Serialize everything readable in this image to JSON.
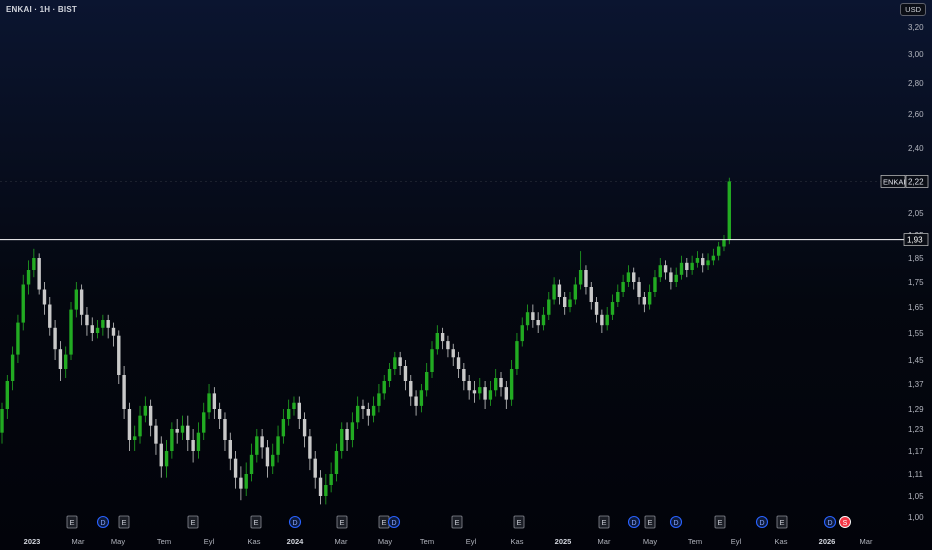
{
  "header": {
    "title": "ENKAI · 1H · BIST",
    "currency": "USD"
  },
  "colors": {
    "background_top": "#0b1530",
    "background_bottom": "#02030a",
    "up_candle": "#22ab22",
    "down_candle": "#c9c9c9",
    "level_line": "#ffffff",
    "axis_text": "#b2b5be"
  },
  "chart_data": {
    "type": "candlestick",
    "title": "ENKAI · 1H · BIST",
    "ylabel": "USD",
    "ylim": [
      1.0,
      3.25
    ],
    "y_ticks": [
      "1,00",
      "1,05",
      "1,11",
      "1,17",
      "1,23",
      "1,29",
      "1,37",
      "1,45",
      "1,55",
      "1,65",
      "1,75",
      "1,85",
      "1,95",
      "2,05",
      "2,40",
      "2,60",
      "2,80",
      "3,00",
      "3,20"
    ],
    "x_ticks": [
      "2023",
      "Mar",
      "May",
      "Tem",
      "Eyl",
      "Kas",
      "2024",
      "Mar",
      "May",
      "Tem",
      "Eyl",
      "Kas",
      "2025",
      "Mar",
      "May",
      "Tem",
      "Eyl",
      "Kas",
      "2026",
      "Mar"
    ],
    "bold_x_ticks": [
      "2023",
      "2024",
      "2025",
      "2026"
    ],
    "horizontal_level": 1.93,
    "price_labels": [
      {
        "symbol": "ENKAI",
        "value": "2,22"
      },
      {
        "value": "1,93"
      }
    ],
    "event_markers": [
      {
        "x": "Jan 2023",
        "label": "E"
      },
      {
        "x": "Apr 2023",
        "label": "D"
      },
      {
        "x": "May 2023",
        "label": "E"
      },
      {
        "x": "Aug 2023",
        "label": "E"
      },
      {
        "x": "Nov 2023",
        "label": "E"
      },
      {
        "x": "Jan 2024",
        "label": "D"
      },
      {
        "x": "Mar 2024",
        "label": "E"
      },
      {
        "x": "May 2024",
        "label": "E"
      },
      {
        "x": "May 2024",
        "label": "D"
      },
      {
        "x": "Aug 2024",
        "label": "E"
      },
      {
        "x": "Oct 2024",
        "label": "E"
      },
      {
        "x": "Mar 2025",
        "label": "E"
      },
      {
        "x": "Apr 2025",
        "label": "D"
      },
      {
        "x": "May 2025",
        "label": "E"
      },
      {
        "x": "Jun 2025",
        "label": "D"
      },
      {
        "x": "Aug 2025",
        "label": "E"
      },
      {
        "x": "Oct 2025",
        "label": "D"
      },
      {
        "x": "Nov 2025",
        "label": "E"
      },
      {
        "x": "Feb 2026",
        "label": "D"
      },
      {
        "x": "Feb 2026",
        "label": "S"
      }
    ],
    "x_range": [
      0,
      162
    ],
    "candles": [
      [
        0,
        1.22,
        1.29,
        1.19,
        1.31
      ],
      [
        1,
        1.29,
        1.38,
        1.26,
        1.4
      ],
      [
        2,
        1.38,
        1.47,
        1.35,
        1.5
      ],
      [
        3,
        1.47,
        1.59,
        1.44,
        1.62
      ],
      [
        4,
        1.59,
        1.74,
        1.56,
        1.78
      ],
      [
        5,
        1.74,
        1.8,
        1.7,
        1.84
      ],
      [
        6,
        1.8,
        1.85,
        1.77,
        1.89
      ],
      [
        7,
        1.85,
        1.72,
        1.7,
        1.87
      ],
      [
        8,
        1.72,
        1.66,
        1.62,
        1.75
      ],
      [
        9,
        1.66,
        1.57,
        1.54,
        1.69
      ],
      [
        10,
        1.57,
        1.49,
        1.45,
        1.6
      ],
      [
        11,
        1.49,
        1.42,
        1.38,
        1.52
      ],
      [
        12,
        1.42,
        1.47,
        1.39,
        1.5
      ],
      [
        13,
        1.47,
        1.64,
        1.45,
        1.67
      ],
      [
        14,
        1.64,
        1.72,
        1.61,
        1.75
      ],
      [
        15,
        1.72,
        1.62,
        1.58,
        1.74
      ],
      [
        16,
        1.62,
        1.58,
        1.54,
        1.65
      ],
      [
        17,
        1.58,
        1.55,
        1.52,
        1.61
      ],
      [
        18,
        1.55,
        1.57,
        1.53,
        1.6
      ],
      [
        19,
        1.57,
        1.6,
        1.54,
        1.62
      ],
      [
        20,
        1.6,
        1.57,
        1.53,
        1.62
      ],
      [
        21,
        1.57,
        1.54,
        1.5,
        1.59
      ],
      [
        22,
        1.54,
        1.4,
        1.37,
        1.56
      ],
      [
        23,
        1.4,
        1.29,
        1.26,
        1.43
      ],
      [
        24,
        1.29,
        1.2,
        1.17,
        1.31
      ],
      [
        25,
        1.2,
        1.21,
        1.17,
        1.24
      ],
      [
        26,
        1.21,
        1.27,
        1.19,
        1.3
      ],
      [
        27,
        1.27,
        1.3,
        1.25,
        1.33
      ],
      [
        28,
        1.3,
        1.24,
        1.21,
        1.32
      ],
      [
        29,
        1.24,
        1.19,
        1.16,
        1.26
      ],
      [
        30,
        1.19,
        1.13,
        1.1,
        1.21
      ],
      [
        31,
        1.13,
        1.17,
        1.1,
        1.2
      ],
      [
        32,
        1.17,
        1.23,
        1.15,
        1.25
      ],
      [
        33,
        1.23,
        1.22,
        1.19,
        1.26
      ],
      [
        34,
        1.22,
        1.24,
        1.2,
        1.27
      ],
      [
        35,
        1.24,
        1.2,
        1.17,
        1.27
      ],
      [
        36,
        1.2,
        1.17,
        1.14,
        1.23
      ],
      [
        37,
        1.17,
        1.22,
        1.15,
        1.25
      ],
      [
        38,
        1.22,
        1.28,
        1.2,
        1.31
      ],
      [
        39,
        1.28,
        1.34,
        1.26,
        1.37
      ],
      [
        40,
        1.34,
        1.29,
        1.26,
        1.36
      ],
      [
        41,
        1.29,
        1.26,
        1.23,
        1.31
      ],
      [
        42,
        1.26,
        1.2,
        1.17,
        1.28
      ],
      [
        43,
        1.2,
        1.15,
        1.12,
        1.22
      ],
      [
        44,
        1.15,
        1.1,
        1.07,
        1.17
      ],
      [
        45,
        1.1,
        1.07,
        1.04,
        1.13
      ],
      [
        46,
        1.07,
        1.11,
        1.05,
        1.14
      ],
      [
        47,
        1.11,
        1.16,
        1.09,
        1.19
      ],
      [
        48,
        1.16,
        1.21,
        1.14,
        1.23
      ],
      [
        49,
        1.21,
        1.18,
        1.15,
        1.23
      ],
      [
        50,
        1.18,
        1.13,
        1.1,
        1.2
      ],
      [
        51,
        1.13,
        1.16,
        1.11,
        1.19
      ],
      [
        52,
        1.16,
        1.21,
        1.14,
        1.24
      ],
      [
        53,
        1.21,
        1.26,
        1.19,
        1.29
      ],
      [
        54,
        1.26,
        1.29,
        1.24,
        1.32
      ],
      [
        55,
        1.29,
        1.31,
        1.27,
        1.33
      ],
      [
        56,
        1.31,
        1.26,
        1.23,
        1.33
      ],
      [
        57,
        1.26,
        1.21,
        1.18,
        1.28
      ],
      [
        58,
        1.21,
        1.15,
        1.12,
        1.23
      ],
      [
        59,
        1.15,
        1.1,
        1.07,
        1.17
      ],
      [
        60,
        1.1,
        1.05,
        1.03,
        1.12
      ],
      [
        61,
        1.05,
        1.08,
        1.03,
        1.11
      ],
      [
        62,
        1.08,
        1.11,
        1.06,
        1.14
      ],
      [
        63,
        1.11,
        1.17,
        1.09,
        1.19
      ],
      [
        64,
        1.17,
        1.23,
        1.15,
        1.25
      ],
      [
        65,
        1.23,
        1.2,
        1.17,
        1.25
      ],
      [
        66,
        1.2,
        1.25,
        1.18,
        1.28
      ],
      [
        67,
        1.25,
        1.3,
        1.23,
        1.33
      ],
      [
        68,
        1.3,
        1.29,
        1.26,
        1.32
      ],
      [
        69,
        1.29,
        1.27,
        1.24,
        1.31
      ],
      [
        70,
        1.27,
        1.3,
        1.25,
        1.33
      ],
      [
        71,
        1.3,
        1.34,
        1.28,
        1.37
      ],
      [
        72,
        1.34,
        1.38,
        1.32,
        1.4
      ],
      [
        73,
        1.38,
        1.42,
        1.36,
        1.44
      ],
      [
        74,
        1.42,
        1.46,
        1.4,
        1.48
      ],
      [
        75,
        1.46,
        1.43,
        1.4,
        1.48
      ],
      [
        76,
        1.43,
        1.38,
        1.35,
        1.45
      ],
      [
        77,
        1.38,
        1.33,
        1.3,
        1.4
      ],
      [
        78,
        1.33,
        1.3,
        1.27,
        1.35
      ],
      [
        79,
        1.3,
        1.35,
        1.28,
        1.37
      ],
      [
        80,
        1.35,
        1.41,
        1.33,
        1.44
      ],
      [
        81,
        1.41,
        1.49,
        1.39,
        1.52
      ],
      [
        82,
        1.49,
        1.55,
        1.47,
        1.58
      ],
      [
        83,
        1.55,
        1.52,
        1.49,
        1.57
      ],
      [
        84,
        1.52,
        1.49,
        1.46,
        1.54
      ],
      [
        85,
        1.49,
        1.46,
        1.43,
        1.51
      ],
      [
        86,
        1.46,
        1.42,
        1.39,
        1.48
      ],
      [
        87,
        1.42,
        1.38,
        1.35,
        1.44
      ],
      [
        88,
        1.38,
        1.35,
        1.32,
        1.4
      ],
      [
        89,
        1.35,
        1.34,
        1.31,
        1.38
      ],
      [
        90,
        1.34,
        1.36,
        1.32,
        1.39
      ],
      [
        91,
        1.36,
        1.32,
        1.29,
        1.38
      ],
      [
        92,
        1.32,
        1.35,
        1.3,
        1.38
      ],
      [
        93,
        1.35,
        1.39,
        1.33,
        1.42
      ],
      [
        94,
        1.39,
        1.36,
        1.33,
        1.41
      ],
      [
        95,
        1.36,
        1.32,
        1.29,
        1.38
      ],
      [
        96,
        1.32,
        1.42,
        1.3,
        1.45
      ],
      [
        97,
        1.42,
        1.52,
        1.4,
        1.55
      ],
      [
        98,
        1.52,
        1.58,
        1.5,
        1.61
      ],
      [
        99,
        1.58,
        1.63,
        1.56,
        1.66
      ],
      [
        100,
        1.63,
        1.6,
        1.57,
        1.66
      ],
      [
        101,
        1.6,
        1.58,
        1.55,
        1.63
      ],
      [
        102,
        1.58,
        1.62,
        1.56,
        1.65
      ],
      [
        103,
        1.62,
        1.68,
        1.6,
        1.71
      ],
      [
        104,
        1.68,
        1.74,
        1.66,
        1.77
      ],
      [
        105,
        1.74,
        1.69,
        1.66,
        1.76
      ],
      [
        106,
        1.69,
        1.65,
        1.62,
        1.71
      ],
      [
        107,
        1.65,
        1.68,
        1.63,
        1.71
      ],
      [
        108,
        1.68,
        1.74,
        1.66,
        1.77
      ],
      [
        109,
        1.74,
        1.8,
        1.72,
        1.88
      ],
      [
        110,
        1.8,
        1.73,
        1.7,
        1.82
      ],
      [
        111,
        1.73,
        1.67,
        1.64,
        1.75
      ],
      [
        112,
        1.67,
        1.62,
        1.59,
        1.69
      ],
      [
        113,
        1.62,
        1.58,
        1.55,
        1.64
      ],
      [
        114,
        1.58,
        1.62,
        1.56,
        1.65
      ],
      [
        115,
        1.62,
        1.67,
        1.6,
        1.7
      ],
      [
        116,
        1.67,
        1.71,
        1.65,
        1.74
      ],
      [
        117,
        1.71,
        1.75,
        1.69,
        1.78
      ],
      [
        118,
        1.75,
        1.79,
        1.73,
        1.82
      ],
      [
        119,
        1.79,
        1.75,
        1.72,
        1.81
      ],
      [
        120,
        1.75,
        1.69,
        1.66,
        1.77
      ],
      [
        121,
        1.69,
        1.66,
        1.63,
        1.71
      ],
      [
        122,
        1.66,
        1.71,
        1.64,
        1.74
      ],
      [
        123,
        1.71,
        1.77,
        1.69,
        1.8
      ],
      [
        124,
        1.77,
        1.82,
        1.75,
        1.85
      ],
      [
        125,
        1.82,
        1.79,
        1.76,
        1.84
      ],
      [
        126,
        1.79,
        1.75,
        1.72,
        1.81
      ],
      [
        127,
        1.75,
        1.78,
        1.73,
        1.81
      ],
      [
        128,
        1.78,
        1.83,
        1.76,
        1.86
      ],
      [
        129,
        1.83,
        1.8,
        1.77,
        1.85
      ],
      [
        130,
        1.8,
        1.83,
        1.78,
        1.86
      ],
      [
        131,
        1.83,
        1.85,
        1.81,
        1.88
      ],
      [
        132,
        1.85,
        1.82,
        1.79,
        1.87
      ],
      [
        133,
        1.82,
        1.84,
        1.8,
        1.87
      ],
      [
        134,
        1.84,
        1.86,
        1.82,
        1.89
      ],
      [
        135,
        1.86,
        1.9,
        1.84,
        1.92
      ],
      [
        136,
        1.9,
        1.93,
        1.88,
        1.95
      ],
      [
        137,
        1.93,
        2.22,
        1.91,
        2.24
      ]
    ]
  }
}
